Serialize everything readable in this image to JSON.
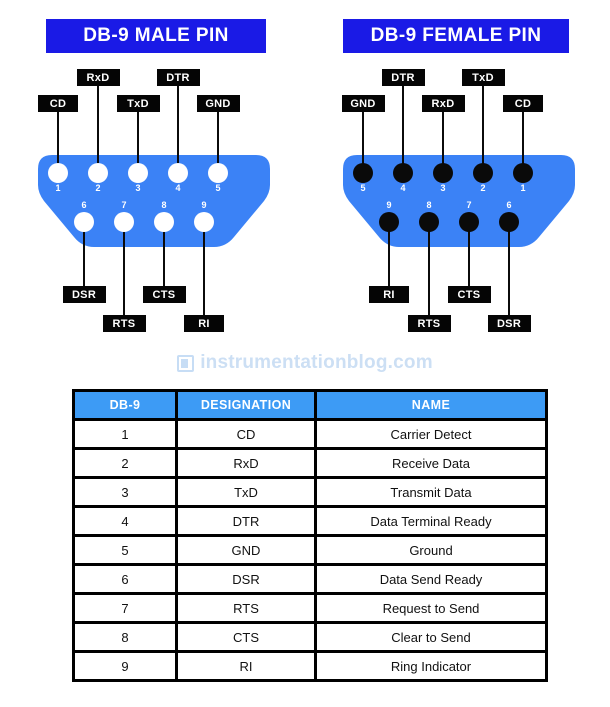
{
  "colors": {
    "title_banner_bg": "#1a1ae6",
    "connector_body": "#3b82f6",
    "table_header_bg": "#3d9bf5",
    "chip_bg": "#050505",
    "watermark": "#ccdff4"
  },
  "male": {
    "title": "DB-9 MALE PIN",
    "top_pins": [
      {
        "number": "1",
        "label": "CD",
        "row": "lower"
      },
      {
        "number": "2",
        "label": "RxD",
        "row": "upper"
      },
      {
        "number": "3",
        "label": "TxD",
        "row": "lower"
      },
      {
        "number": "4",
        "label": "DTR",
        "row": "upper"
      },
      {
        "number": "5",
        "label": "GND",
        "row": "lower"
      }
    ],
    "bottom_pins": [
      {
        "number": "6",
        "label": "DSR",
        "row": "upper"
      },
      {
        "number": "7",
        "label": "RTS",
        "row": "lower"
      },
      {
        "number": "8",
        "label": "CTS",
        "row": "upper"
      },
      {
        "number": "9",
        "label": "RI",
        "row": "lower"
      }
    ]
  },
  "female": {
    "title": "DB-9 FEMALE PIN",
    "top_pins": [
      {
        "number": "5",
        "label": "GND",
        "row": "lower"
      },
      {
        "number": "4",
        "label": "DTR",
        "row": "upper"
      },
      {
        "number": "3",
        "label": "RxD",
        "row": "lower"
      },
      {
        "number": "2",
        "label": "TxD",
        "row": "upper"
      },
      {
        "number": "1",
        "label": "CD",
        "row": "lower"
      }
    ],
    "bottom_pins": [
      {
        "number": "9",
        "label": "RI",
        "row": "upper"
      },
      {
        "number": "8",
        "label": "RTS",
        "row": "lower"
      },
      {
        "number": "7",
        "label": "CTS",
        "row": "upper"
      },
      {
        "number": "6",
        "label": "DSR",
        "row": "lower"
      }
    ]
  },
  "watermark": {
    "text": "instrumentationblog.com",
    "icon": "monitor-icon"
  },
  "table": {
    "headers": [
      "DB-9",
      "DESIGNATION",
      "NAME"
    ],
    "rows": [
      [
        "1",
        "CD",
        "Carrier Detect"
      ],
      [
        "2",
        "RxD",
        "Receive Data"
      ],
      [
        "3",
        "TxD",
        "Transmit Data"
      ],
      [
        "4",
        "DTR",
        "Data Terminal Ready"
      ],
      [
        "5",
        "GND",
        "Ground"
      ],
      [
        "6",
        "DSR",
        "Data Send Ready"
      ],
      [
        "7",
        "RTS",
        "Request to Send"
      ],
      [
        "8",
        "CTS",
        "Clear to Send"
      ],
      [
        "9",
        "RI",
        "Ring Indicator"
      ]
    ]
  }
}
